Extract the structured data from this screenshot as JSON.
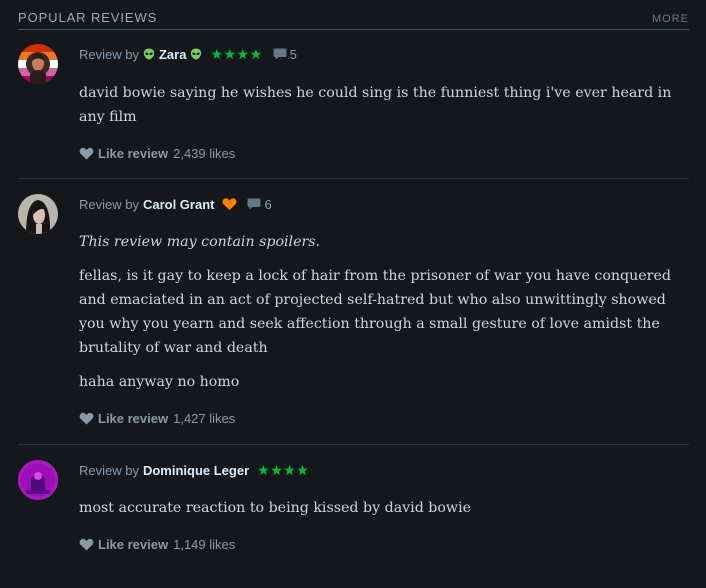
{
  "section": {
    "title": "POPULAR REVIEWS",
    "more_label": "MORE"
  },
  "colors": {
    "background": "#14181c",
    "star_green": "#00c030",
    "patron_orange": "#ff8000",
    "muted_text": "#8899aa",
    "name_text": "#ddeeff"
  },
  "reviews": [
    {
      "review_by_label": "Review by",
      "reviewer": "Zara",
      "badge_icon": "alien-icon",
      "stars": "★★★★",
      "rating": 4,
      "comments": "5",
      "text": "david bowie saying he wishes he could sing is the funniest thing i've ever heard in any film",
      "like_label": "Like review",
      "likes": "2,439 likes"
    },
    {
      "review_by_label": "Review by",
      "reviewer": "Carol Grant",
      "badge_icon": "heart-icon",
      "comments": "6",
      "spoiler_notice": "This review may contain spoilers.",
      "paragraphs": [
        "fellas, is it gay to keep a lock of hair from the prisoner of war you have conquered and emaciated in an act of projected self-hatred but who also unwittingly showed you why you yearn and seek affection through a small gesture of love amidst the brutality of war and death",
        "haha anyway no homo"
      ],
      "like_label": "Like review",
      "likes": "1,427 likes"
    },
    {
      "review_by_label": "Review by",
      "reviewer": "Dominique Leger",
      "stars": "★★★★",
      "rating": 4,
      "text": "most accurate reaction to being kissed by david bowie",
      "like_label": "Like review",
      "likes": "1,149 likes"
    }
  ]
}
